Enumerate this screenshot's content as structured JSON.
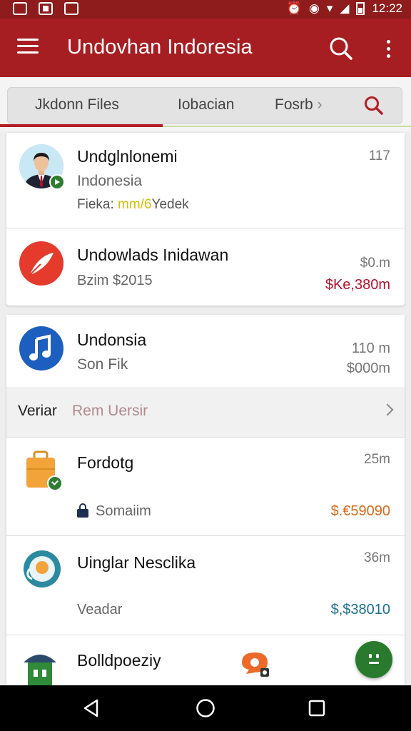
{
  "status_bar": {
    "time": "12:22"
  },
  "app_bar": {
    "title": "Undovhan Indoresia"
  },
  "tabs": [
    {
      "label": "Jkdonn Files"
    },
    {
      "label": "Iobacian"
    },
    {
      "label": "Fosrb"
    }
  ],
  "list": [
    {
      "title": "Undglnlonemi",
      "subtitle": "Indonesia",
      "detail_prefix": "Fieka: ",
      "detail_highlight": "mm/6",
      "detail_suffix": "Yedek",
      "meta": "117"
    },
    {
      "title": "Undowlads Inidawan",
      "subtitle": "Bzim $2015",
      "meta": "$0.m",
      "price": "$Ke,380m"
    },
    {
      "title": "Undonsia",
      "subtitle": "Son Fik",
      "meta": "110 m",
      "price": "$000m"
    },
    {
      "title": "Fordotg",
      "subtitle": "Somaiim",
      "meta": "25m",
      "price": "$.€59090"
    },
    {
      "title": "Uinglar Nesclika",
      "subtitle": "Veadar",
      "meta": "36m",
      "price": "$,$38010"
    },
    {
      "title": "Bolldpoeziy"
    }
  ],
  "section_header": {
    "label": "Veriar",
    "sublabel": "Rem Uersir"
  },
  "colors": {
    "primary": "#a61e22",
    "status_bar": "#8e1c1c",
    "accent_green": "#2e7d32",
    "price_red": "#b3122e",
    "price_orange": "#d8691a",
    "price_teal": "#1b6f8e",
    "highlight_yellow": "#e3c600"
  },
  "icons": [
    "menu-icon",
    "search-icon",
    "more-vert-icon",
    "avatar-person",
    "red-feather-icon",
    "music-note-icon",
    "briefcase-icon",
    "teal-globe-icon",
    "lock-icon",
    "house-icon",
    "orange-chat-icon",
    "smile-fab-icon",
    "back-icon",
    "home-icon",
    "recents-icon"
  ]
}
